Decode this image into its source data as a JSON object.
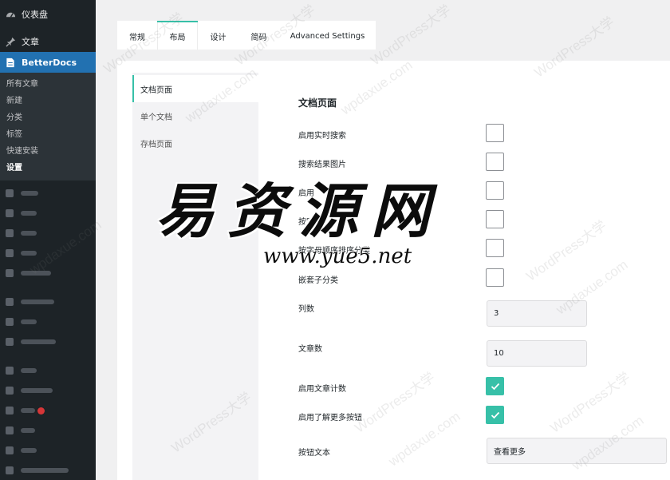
{
  "sidebar": {
    "dashboard": "仪表盘",
    "posts": "文章",
    "plugin": "BetterDocs",
    "submenu": [
      "所有文章",
      "新建",
      "分类",
      "标签",
      "快速安装",
      "设置"
    ],
    "active_submenu": "设置"
  },
  "tabs": [
    {
      "label": "常规",
      "active": false
    },
    {
      "label": "布局",
      "active": true
    },
    {
      "label": "设计",
      "active": false
    },
    {
      "label": "简码",
      "active": false
    },
    {
      "label": "Advanced Settings",
      "active": false
    }
  ],
  "subnav": [
    {
      "label": "文档页面",
      "active": true
    },
    {
      "label": "单个文档",
      "active": false
    },
    {
      "label": "存档页面",
      "active": false
    }
  ],
  "section": {
    "title": "文档页面",
    "rows": [
      {
        "label": "启用实时搜索",
        "type": "checkbox",
        "checked": false
      },
      {
        "label": "搜索结果图片",
        "type": "checkbox",
        "checked": false
      },
      {
        "label": "启用",
        "type": "checkbox",
        "checked": false
      },
      {
        "label": "按字",
        "type": "checkbox",
        "checked": false
      },
      {
        "label": "按字母顺序排序分类",
        "type": "checkbox",
        "checked": false
      },
      {
        "label": "嵌套子分类",
        "type": "checkbox",
        "checked": false
      },
      {
        "label": "列数",
        "type": "number",
        "value": "3"
      },
      {
        "label": "文章数",
        "type": "number",
        "value": "10"
      },
      {
        "label": "启用文章计数",
        "type": "checkbox",
        "checked": true
      },
      {
        "label": "启用了解更多按钮",
        "type": "checkbox",
        "checked": true
      },
      {
        "label": "按钮文本",
        "type": "text",
        "value": "查看更多"
      }
    ]
  },
  "watermark": {
    "site": "WordPress大学",
    "domain": "wpdaxue.com",
    "overlay_title": "易资源网",
    "overlay_url": "www.yue5.net"
  },
  "colors": {
    "sidebar_bg": "#1d2327",
    "sidebar_active": "#2271b1",
    "accent": "#37c0a8"
  }
}
